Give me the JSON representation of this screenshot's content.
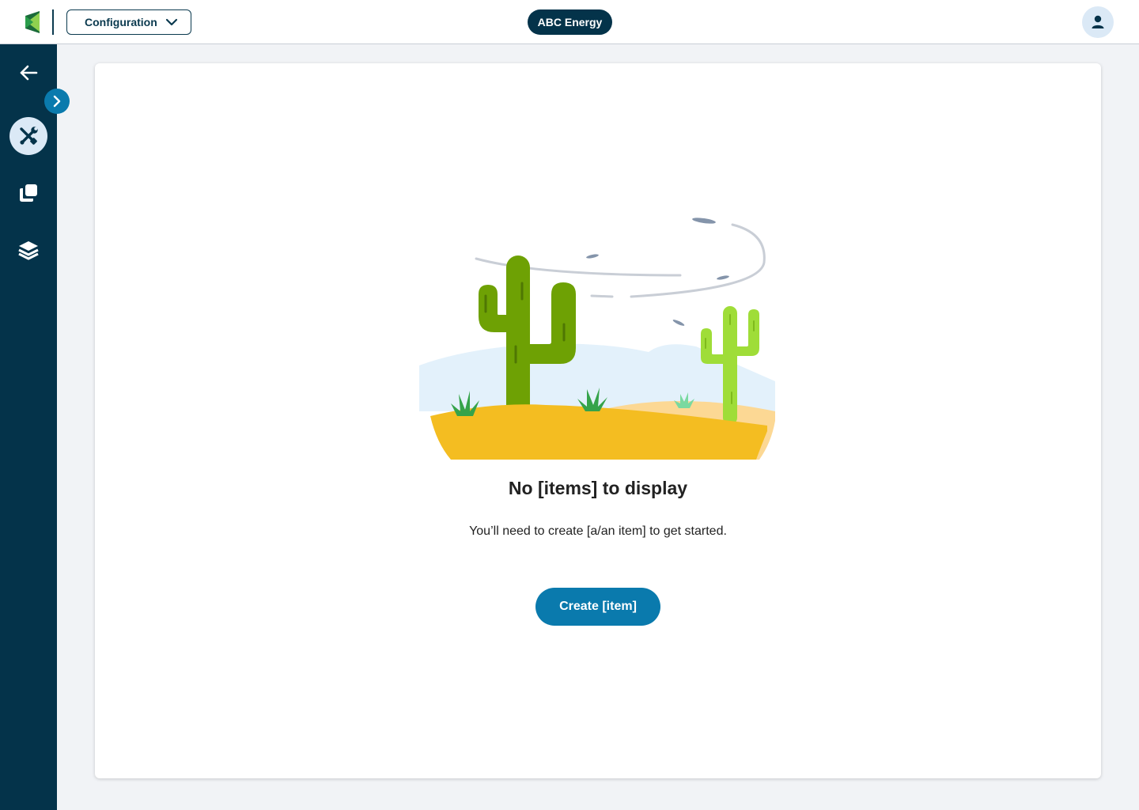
{
  "header": {
    "context_select": {
      "value": "Configuration"
    },
    "tenant": "ABC Energy"
  },
  "sidebar": {
    "items": [
      {
        "name": "back",
        "icon": "arrow-left-icon"
      },
      {
        "name": "configuration",
        "icon": "tools-icon",
        "active": true
      },
      {
        "name": "copies",
        "icon": "copy-icon"
      },
      {
        "name": "layers",
        "icon": "layers-icon"
      }
    ],
    "expand_icon": "chevron-right-icon"
  },
  "empty_state": {
    "title": "No [items] to display",
    "description": "You’ll need to create [a/an item] to get started.",
    "button_label": "Create [item]"
  },
  "colors": {
    "navy": "#04334a",
    "accent": "#0a7aad",
    "active_bg": "#dbe9f6",
    "background": "#f1f3f6"
  }
}
